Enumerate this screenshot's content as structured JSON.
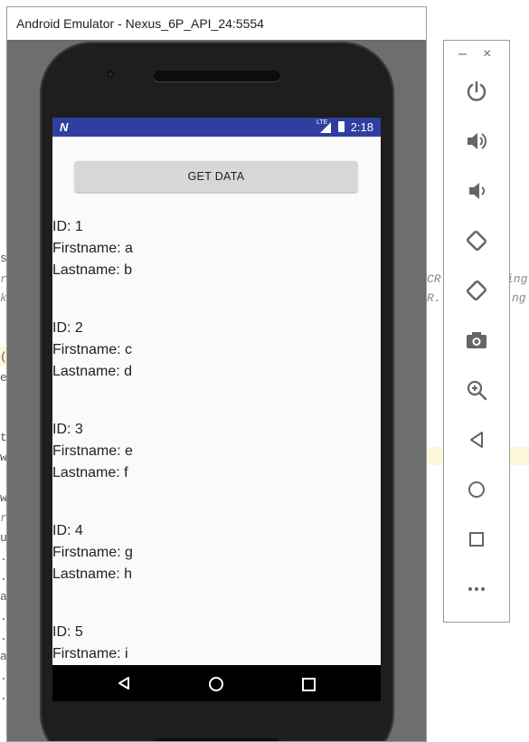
{
  "window": {
    "title": "Android Emulator - Nexus_6P_API_24:5554"
  },
  "status_bar": {
    "carrier_icon": "N",
    "lte": "LTE",
    "time": "2:18"
  },
  "app": {
    "button_label": "GET DATA",
    "records": [
      {
        "id": "ID: 1",
        "firstname": "Firstname: a",
        "lastname": "Lastname: b"
      },
      {
        "id": "ID: 2",
        "firstname": "Firstname: c",
        "lastname": "Lastname: d"
      },
      {
        "id": "ID: 3",
        "firstname": "Firstname: e",
        "lastname": "Lastname: f"
      },
      {
        "id": "ID: 4",
        "firstname": "Firstname: g",
        "lastname": "Lastname: h"
      },
      {
        "id": "ID: 5",
        "firstname": "Firstname: i"
      }
    ]
  },
  "side_panel": {
    "minimize": "–",
    "close": "×",
    "buttons": [
      "power",
      "volume-up",
      "volume-down",
      "rotate-left",
      "rotate-right",
      "screenshot",
      "zoom",
      "back",
      "home",
      "overview",
      "more"
    ]
  },
  "background_fragments": {
    "f1": "s",
    "f2": "r",
    "f3": "k",
    "f4": "(",
    "f5": "e",
    "f6": "t",
    "f7": "w",
    "f8": "w",
    "f9": "r",
    "f10": "u",
    "f11": ".",
    "f12": ".",
    "f13": "a",
    "f14": ".",
    "f15": ".",
    "f16": "a",
    "f17": ".",
    "f18": ".",
    "r1": "CR",
    "r2": "ing",
    "r3": "R.",
    "r4": "ng"
  },
  "colors": {
    "status_bar": "#303f9f",
    "screen_bg": "#fafafa",
    "button_bg": "#d6d7d7"
  }
}
